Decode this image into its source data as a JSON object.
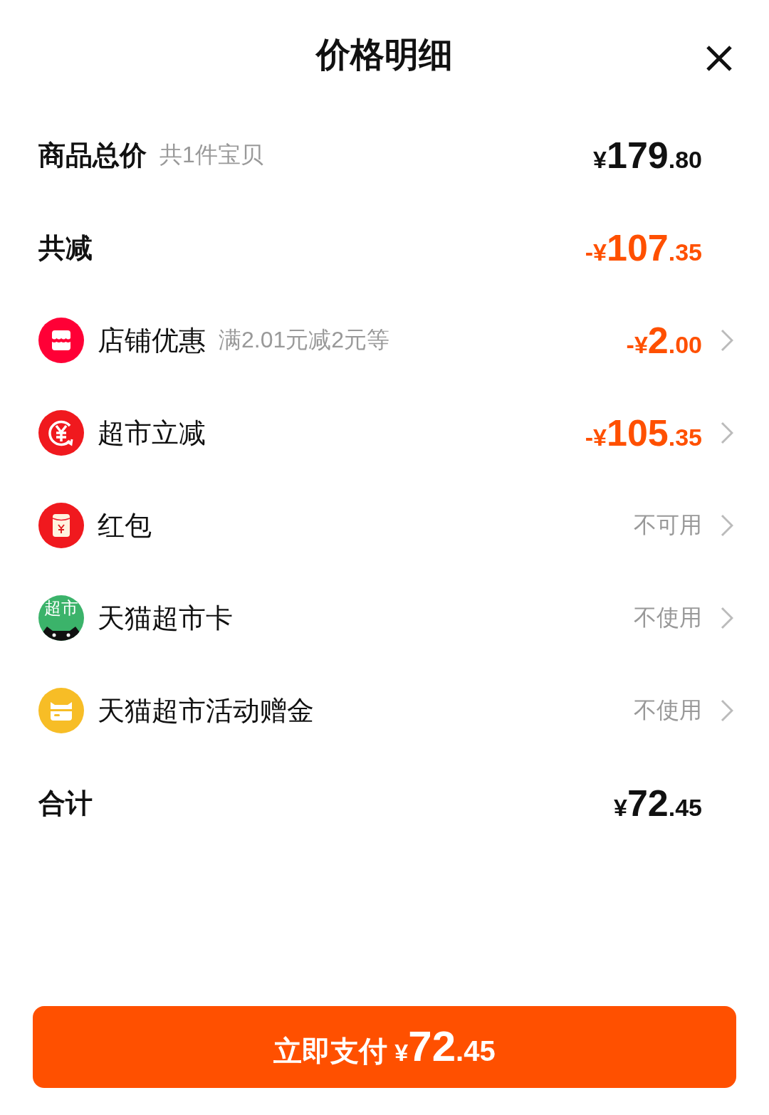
{
  "title": "价格明细",
  "rows": [
    {
      "kind": "header",
      "label": "商品总价",
      "note": "共1件宝贝",
      "value": {
        "prefix": "¥",
        "int": "179",
        "dec": ".80"
      },
      "negative": false
    },
    {
      "kind": "header",
      "label": "共减",
      "value": {
        "prefix": "-¥",
        "int": "107",
        "dec": ".35"
      },
      "negative": true
    },
    {
      "kind": "shop",
      "label": "店铺优惠",
      "note": "满2.01元减2元等",
      "value": {
        "prefix": "-¥",
        "int": "2",
        "dec": ".00"
      },
      "negative": true,
      "arrow": true
    },
    {
      "kind": "discount",
      "label": "超市立减",
      "value": {
        "prefix": "-¥",
        "int": "105",
        "dec": ".35"
      },
      "negative": true,
      "arrow": true
    },
    {
      "kind": "envelope",
      "label": "红包",
      "status": "不可用",
      "arrow": true
    },
    {
      "kind": "card",
      "icon_text": "超市",
      "label": "天猫超市卡",
      "status": "不使用",
      "arrow": true
    },
    {
      "kind": "gift",
      "label": "天猫超市活动赠金",
      "status": "不使用",
      "arrow": true
    },
    {
      "kind": "header",
      "label": "合计",
      "value": {
        "prefix": "¥",
        "int": "72",
        "dec": ".45"
      },
      "negative": false
    }
  ],
  "pay_button": {
    "label": "立即支付",
    "value": {
      "prefix": "¥",
      "int": "72",
      "dec": ".45"
    }
  }
}
